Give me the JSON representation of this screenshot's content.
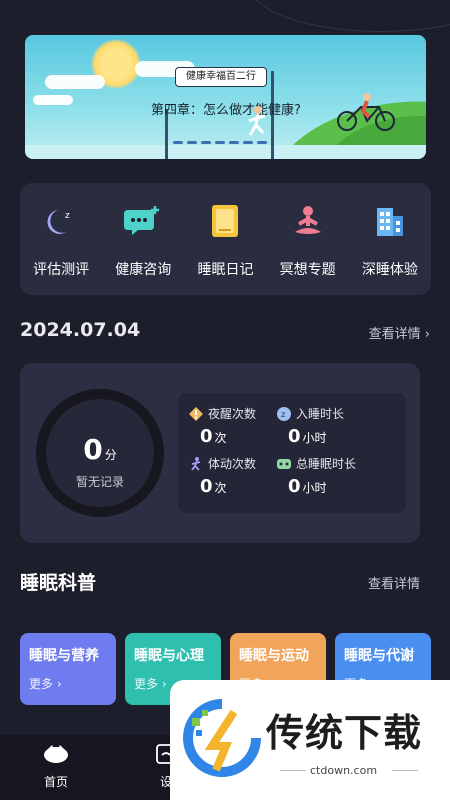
{
  "banner": {
    "pill_text": "健康幸福百二行",
    "chapter_text": "第四章：怎么做才能健康?"
  },
  "features": [
    {
      "label": "评估测评",
      "icon": "moon-icon"
    },
    {
      "label": "健康咨询",
      "icon": "chat-icon"
    },
    {
      "label": "睡眠日记",
      "icon": "diary-icon"
    },
    {
      "label": "冥想专题",
      "icon": "meditation-icon"
    },
    {
      "label": "深睡体验",
      "icon": "building-icon"
    }
  ],
  "date_row": {
    "date": "2024.07.04",
    "more": "查看详情 ›"
  },
  "stats": {
    "score": "0",
    "score_unit": "分",
    "no_record": "暂无记录",
    "metrics": [
      {
        "label": "夜醒次数",
        "value": "0",
        "unit": "次",
        "icon": "alert-icon"
      },
      {
        "label": "入睡时长",
        "value": "0",
        "unit": "小时",
        "icon": "sleep-moon-icon"
      },
      {
        "label": "体动次数",
        "value": "0",
        "unit": "次",
        "icon": "movement-icon"
      },
      {
        "label": "总睡眠时长",
        "value": "0",
        "unit": "小时",
        "icon": "bed-icon"
      }
    ]
  },
  "science": {
    "title": "睡眠科普",
    "more": "查看详情",
    "cards": [
      {
        "title": "睡眠与营养",
        "more": "更多 ›",
        "color": "#6f7cf0"
      },
      {
        "title": "睡眠与心理",
        "more": "更多 ›",
        "color": "#2fbfae"
      },
      {
        "title": "睡眠与运动",
        "more": "更多 ›",
        "color": "#f0a55a"
      },
      {
        "title": "睡眠与代谢",
        "more": "更多 ›",
        "color": "#4a8ff0"
      }
    ]
  },
  "nav": [
    {
      "label": "首页",
      "icon": "home-icon"
    },
    {
      "label": "设",
      "icon": "settings-icon"
    }
  ],
  "watermark": {
    "brand": "传统下载",
    "url": "ctdown.com"
  }
}
